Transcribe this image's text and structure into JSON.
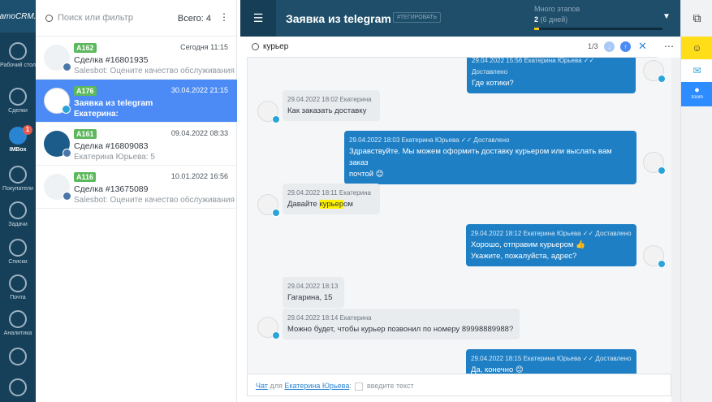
{
  "nav": {
    "logo": "amoCRM.",
    "items": [
      {
        "label": "Рабочий стол",
        "icon": "dashboard-icon"
      },
      {
        "label": "Сделки",
        "icon": "dollar-icon"
      },
      {
        "label": "IMBox",
        "icon": "chat-icon",
        "badge": "1",
        "active": true
      },
      {
        "label": "Покупатели",
        "icon": "customers-icon"
      },
      {
        "label": "Задачи",
        "icon": "check-icon"
      },
      {
        "label": "Списки",
        "icon": "list-icon"
      },
      {
        "label": "Почта",
        "icon": "mail-icon"
      },
      {
        "label": "Аналитика",
        "icon": "analytics-icon"
      },
      {
        "label": "",
        "icon": "settings-icon"
      }
    ]
  },
  "list": {
    "search_placeholder": "Поиск или фильтр",
    "total": "Всего: 4",
    "items": [
      {
        "tag": "A162",
        "date": "Сегодня 11:15",
        "title": "Сделка #16801935",
        "sub": "Salesbot: Оцените качество обслуживания",
        "selected": false
      },
      {
        "tag": "A176",
        "date": "30.04.2022 21:15",
        "title": "Заявка из telegram",
        "sub": "Екатерина:",
        "selected": true
      },
      {
        "tag": "A161",
        "date": "09.04.2022 08:33",
        "title": "Сделка #16809083",
        "sub": "Екатерина Юрьева: 5",
        "selected": false
      },
      {
        "tag": "A116",
        "date": "10.01.2022 16:56",
        "title": "Сделка #13675089",
        "sub": "Salesbot: Оцените качество обслуживания",
        "selected": false
      }
    ]
  },
  "header": {
    "title": "Заявка из telegram",
    "tag_button": "#ТЕГИРОВАТЬ",
    "stage_label": "Много этапов",
    "stage_value": "2",
    "stage_days": "(6 дней)"
  },
  "chat_search": {
    "query": "курьер",
    "counter": "1/3"
  },
  "messages": {
    "m0": {
      "meta": "29.04.2022 15:56 Екатерина Юрьева ✓✓ Доставлено",
      "text": "Где котики?"
    },
    "m1": {
      "meta": "29.04.2022 18:02 Екатерина",
      "text": "Как заказать доставку"
    },
    "m2": {
      "meta": "29.04.2022 18:03 Екатерина Юрьева ✓✓ Доставлено",
      "text1": "Здравствуйте. Мы можем оформить доставку курьером или выслать вам заказ",
      "text2": "почтой 😊"
    },
    "m3": {
      "meta": "29.04.2022 18:11 Екатерина",
      "pre": "Давайте ",
      "hit": "курьер",
      "post": "ом"
    },
    "m4": {
      "meta": "29.04.2022 18:12 Екатерина Юрьева ✓✓ Доставлено",
      "text1": "Хорошо, отправим курьером 👍",
      "text2": "Укажите, пожалуйста, адрес?"
    },
    "m5": {
      "meta": "29.04.2022 18:13",
      "text": "Гагарина, 15"
    },
    "m6": {
      "meta": "29.04.2022 18:14 Екатерина",
      "text": "Можно будет, чтобы курьер позвонил по номеру 89998889988?"
    },
    "m7": {
      "meta": "29.04.2022 18:15 Екатерина Юрьева ✓✓ Доставлено",
      "text": "Да, конечно 😊"
    }
  },
  "footer": {
    "chat_link": "Чат",
    "for": "для",
    "recipient": "Екатерина Юрьева",
    "colon": ":",
    "placeholder": "введите текст"
  },
  "right_toolbar": {
    "zoom_label": "zoom"
  },
  "colors": {
    "nav_bg": "#16405a",
    "header_bg": "#1e4e6a",
    "selected_row": "#4c8bf5",
    "outgoing_bubble": "#1e7fc5",
    "highlight": "#fff200",
    "tag_green": "#5cb85c"
  }
}
